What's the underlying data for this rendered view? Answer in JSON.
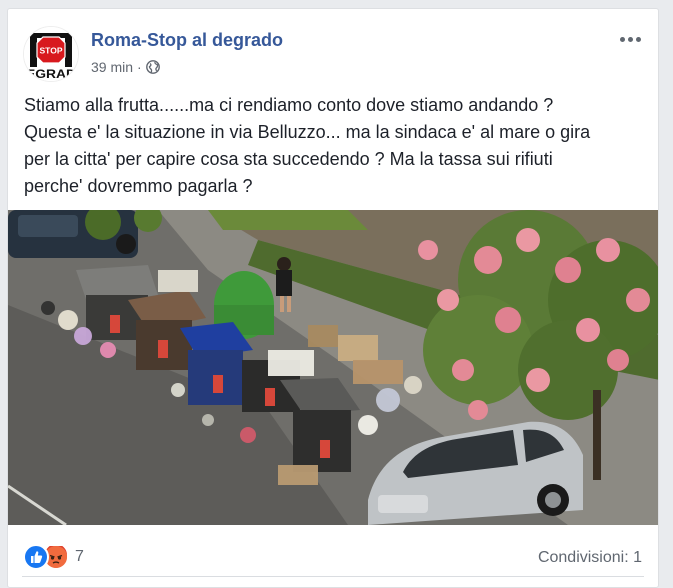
{
  "post": {
    "page_name": "Roma-Stop al degrado",
    "avatar_text_top": "STOP",
    "avatar_text_bottom": "EGRAD",
    "timestamp": "39 min",
    "separator": "·",
    "privacy_icon": "globe-icon",
    "more_icon": "more-options-icon",
    "text_lines": [
      "Stiamo alla frutta......ma ci rendiamo conto dove stiamo andando ?",
      "Questa e' la situazione in via Belluzzo... ma la sindaca e' al mare o gira",
      "per la citta' per capire cosa sta succedendo ? Ma la tassa sui rifiuti",
      "perche' dovremmo pagarla ?"
    ]
  },
  "reactions": {
    "icons": [
      "like-icon",
      "angry-icon"
    ],
    "count": "7"
  },
  "shares": {
    "label": "Condivisioni: 1"
  },
  "colors": {
    "link": "#365899",
    "like": "#1877f2",
    "angry": "#f7714c",
    "text": "#1d2129",
    "muted": "#616770"
  }
}
